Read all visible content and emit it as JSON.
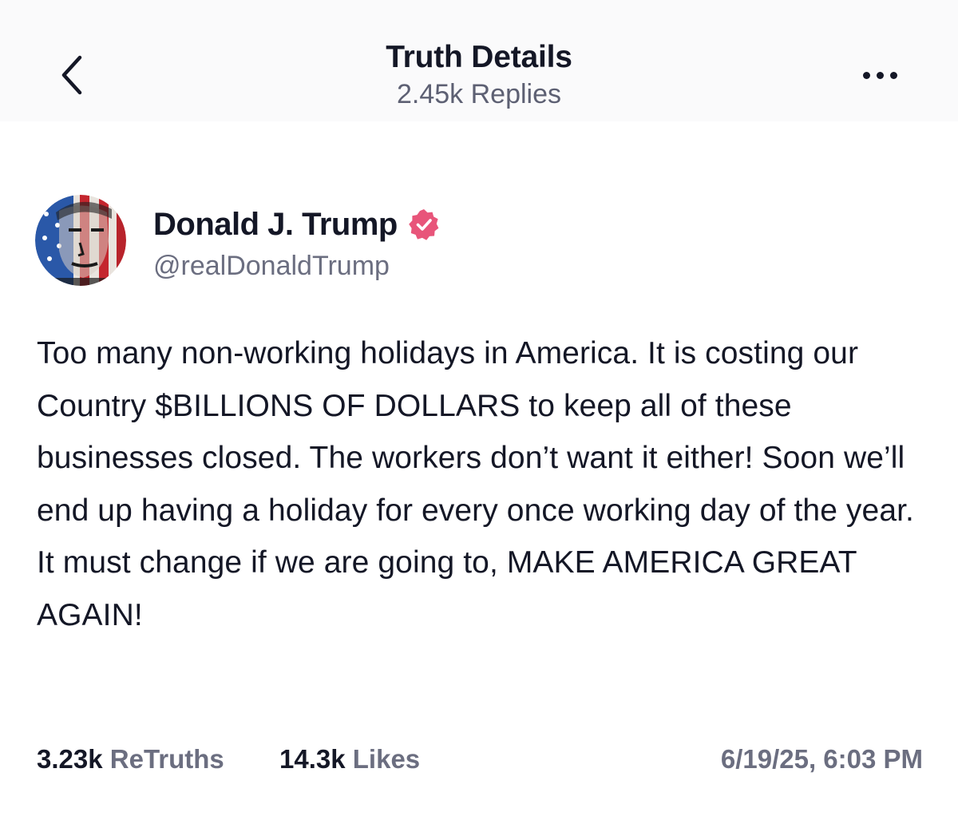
{
  "header": {
    "back_icon": "chevron-left-icon",
    "title": "Truth Details",
    "subtitle": "2.45k Replies",
    "more_icon": "more-horizontal-icon"
  },
  "post": {
    "author": {
      "name": "Donald J. Trump",
      "handle": "@realDonaldTrump",
      "verified_icon": "verified-badge-icon",
      "avatar_icon": "avatar-image"
    },
    "text": "Too many non-working holidays in America. It is costing our Country $BILLIONS OF DOLLARS to keep all of these businesses closed. The workers don’t want it either! Soon we’ll end up having a holiday for every once working day of the year. It must change if we are going to, MAKE AMERICA GREAT AGAIN!",
    "stats": {
      "retruths_count": "3.23k",
      "retruths_label": "ReTruths",
      "likes_count": "14.3k",
      "likes_label": "Likes"
    },
    "timestamp": "6/19/25, 6:03 PM"
  },
  "colors": {
    "text_primary": "#141726",
    "text_secondary": "#6b6e80",
    "header_bg": "#fafafb",
    "verified": "#e8557a"
  }
}
